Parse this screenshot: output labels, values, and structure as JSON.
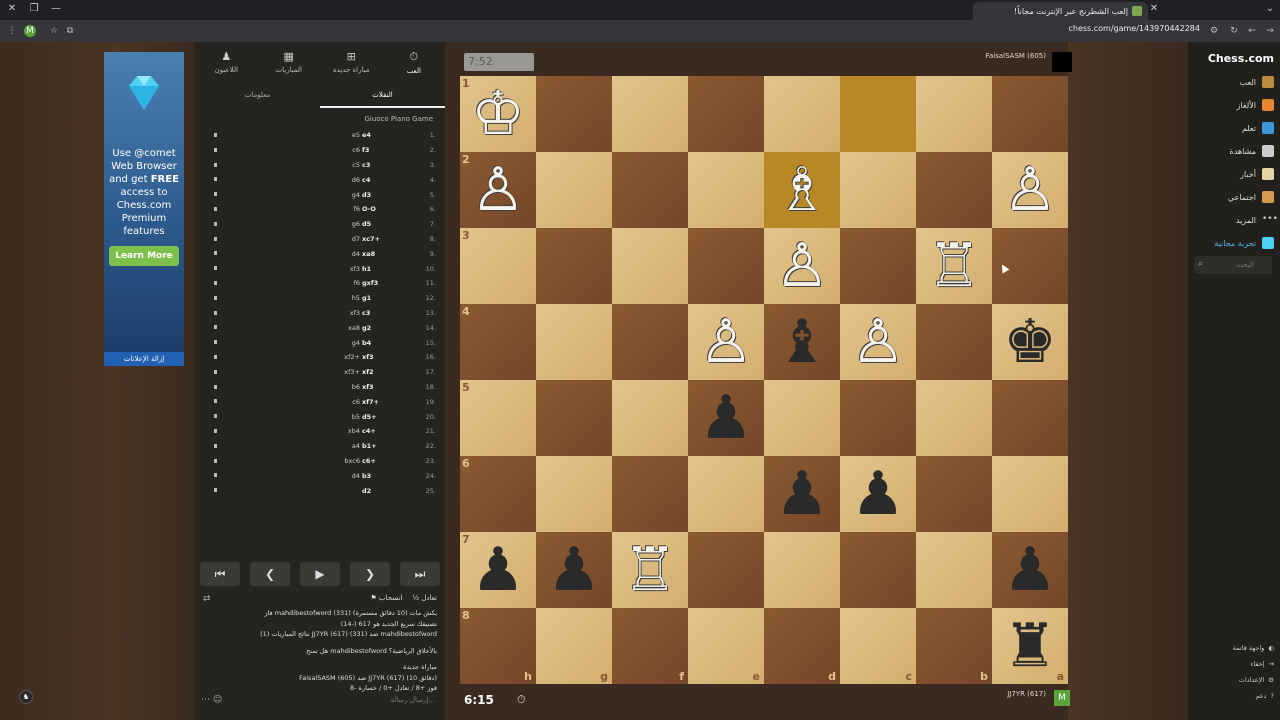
{
  "browser": {
    "tab_title": "إلعب الشطرنج عبر الإنترنت مجاناً!",
    "url": "chess.com/game/143970442284"
  },
  "ad": {
    "text_line1": "Use",
    "brand": "comet",
    "text_rest": "Web Browser and get",
    "free": "FREE",
    "text_end": "access to Chess.com Premium features",
    "cta": "Learn More",
    "remove": "إزالة الإعلانات"
  },
  "panel": {
    "toptabs": [
      {
        "label": "العب",
        "icon": "clock-icon"
      },
      {
        "label": "مباراة جديدة",
        "icon": "plus-icon"
      },
      {
        "label": "المباريات",
        "icon": "grid-icon"
      },
      {
        "label": "اللاعبون",
        "icon": "players-icon"
      }
    ],
    "subtabs": [
      "النقلات",
      "معلومات"
    ],
    "opening": "Giuoco Piano Game",
    "moves": [
      {
        "n": "1.",
        "w": "e4",
        "b": "e5"
      },
      {
        "n": "2.",
        "w": "f3",
        "b": "c6"
      },
      {
        "n": "3.",
        "w": "c3",
        "b": "c5"
      },
      {
        "n": "4.",
        "w": "c4",
        "b": "d6"
      },
      {
        "n": "5.",
        "w": "d3",
        "b": "g4"
      },
      {
        "n": "6.",
        "w": "O-O",
        "b": "f6"
      },
      {
        "n": "7.",
        "w": "d5",
        "b": "g6"
      },
      {
        "n": "8.",
        "w": "xc7+",
        "b": "d7"
      },
      {
        "n": "9.",
        "w": "xa8",
        "b": "d4"
      },
      {
        "n": "10.",
        "w": "h1",
        "b": "xf3"
      },
      {
        "n": "11.",
        "w": "gxf3",
        "b": "f6"
      },
      {
        "n": "12.",
        "w": "g1",
        "b": "h5"
      },
      {
        "n": "13.",
        "w": "c3",
        "b": "xf3"
      },
      {
        "n": "14.",
        "w": "g2",
        "b": "xa8"
      },
      {
        "n": "15.",
        "w": "b4",
        "b": "g4"
      },
      {
        "n": "16.",
        "w": "xf3",
        "b": "xf2+"
      },
      {
        "n": "17.",
        "w": "xf2",
        "b": "xf3+"
      },
      {
        "n": "18.",
        "w": "xf3",
        "b": "b6"
      },
      {
        "n": "19.",
        "w": "xf7+",
        "b": "c6"
      },
      {
        "n": "20.",
        "w": "d5+",
        "b": "b5"
      },
      {
        "n": "21.",
        "w": "c4+",
        "b": "xb4"
      },
      {
        "n": "22.",
        "w": "b1+",
        "b": "a4"
      },
      {
        "n": "23.",
        "w": "c6+",
        "b": "bxc6"
      },
      {
        "n": "24.",
        "w": "b3",
        "b": "d4"
      },
      {
        "n": "25.",
        "w": "d2",
        "b": ""
      }
    ],
    "nav": [
      "⏮",
      "◀",
      "▶",
      "▶︎",
      "⏭"
    ],
    "draw_label": "تعادل",
    "resign_label": "انسحاب",
    "chat": [
      "فاز mahdibestofword (331) بكش مات (10 دقائق مستمرة)",
      "تصنيفك سريع الجديد هو 617 (-14)",
      "نتائج المباريات (1) JJ7YR (617) ضد (331) mahdibestofword",
      "هل تمنح mahdibestofword بالأخلاق الرياضية؟",
      "مباراة جديدة",
      "FaisalSASM (605) ضد JJ7YR (617) (10 دقائق)",
      "فوز +8 / تعادل +0 / خسارة -8"
    ],
    "chat_placeholder": "إرسال رسالة..."
  },
  "game": {
    "top_clock": "7:52",
    "top_player": "FaisalSASM (605)",
    "bottom_clock": "6:15",
    "bottom_player": "JJ7YR (617)",
    "ranks": [
      "1",
      "2",
      "3",
      "4",
      "5",
      "6",
      "7",
      "8"
    ],
    "files": [
      "h",
      "g",
      "f",
      "e",
      "d",
      "c",
      "b",
      "a"
    ],
    "board": [
      [
        "♔",
        "",
        "",
        "",
        "",
        "",
        "",
        ""
      ],
      [
        "♙",
        "",
        "",
        "",
        "♗",
        "",
        "",
        "♙"
      ],
      [
        "",
        "",
        "",
        "",
        "♙",
        "",
        "♖",
        ""
      ],
      [
        "",
        "",
        "",
        "♙",
        "♝",
        "♙",
        "",
        "♚"
      ],
      [
        "",
        "",
        "",
        "♟",
        "",
        "",
        "",
        ""
      ],
      [
        "",
        "",
        "",
        "",
        "♟",
        "♟",
        "",
        ""
      ],
      [
        "♟",
        "♟",
        "♖",
        "",
        "",
        "",
        "",
        "♟"
      ],
      [
        "",
        "",
        "",
        "",
        "",
        "",
        "",
        "♜"
      ]
    ]
  },
  "sidebar": {
    "logo": "Chess.com",
    "items": [
      "العب",
      "الألغاز",
      "تعلم",
      "مشاهدة",
      "أخبار",
      "اجتماعي",
      "المزيد",
      "تجربة مجانية"
    ],
    "search_placeholder": "البحث",
    "bottom": [
      "واجهة قاتمة",
      "إخفاء",
      "الإعدادات",
      "دعم"
    ]
  }
}
